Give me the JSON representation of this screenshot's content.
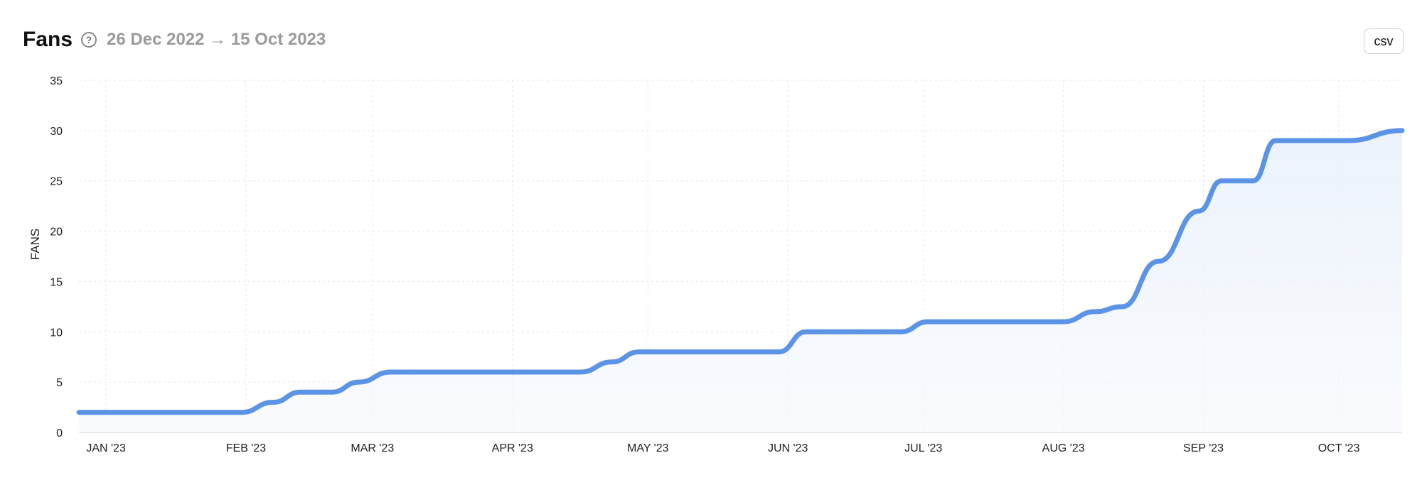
{
  "header": {
    "title": "Fans",
    "date_range": "26 Dec 2022 → 15 Oct 2023",
    "help_icon": "question-circle-icon"
  },
  "toolbar": {
    "csv_label": "csv"
  },
  "colors": {
    "line": "#5b93e6",
    "area_fill": "#eef4fc",
    "grid": "#e6e6e6",
    "axis": "#dddddd"
  },
  "chart_data": {
    "type": "line",
    "title": "Fans",
    "ylabel": "FANS",
    "xlabel": "",
    "ylim": [
      0,
      35
    ],
    "yticks": [
      0,
      5,
      10,
      15,
      20,
      25,
      30,
      35
    ],
    "xlim": [
      "2022-12-26",
      "2023-10-15"
    ],
    "xticks": [
      {
        "date": "2023-01-01",
        "label": "JAN '23"
      },
      {
        "date": "2023-02-01",
        "label": "FEB '23"
      },
      {
        "date": "2023-03-01",
        "label": "MAR '23"
      },
      {
        "date": "2023-04-01",
        "label": "APR '23"
      },
      {
        "date": "2023-05-01",
        "label": "MAY '23"
      },
      {
        "date": "2023-06-01",
        "label": "JUN '23"
      },
      {
        "date": "2023-07-01",
        "label": "JUL '23"
      },
      {
        "date": "2023-08-01",
        "label": "AUG '23"
      },
      {
        "date": "2023-09-01",
        "label": "SEP '23"
      },
      {
        "date": "2023-10-01",
        "label": "OCT '23"
      }
    ],
    "grid": true,
    "series": [
      {
        "points": [
          {
            "x": "2022-12-26",
            "y": 2
          },
          {
            "x": "2023-01-31",
            "y": 2
          },
          {
            "x": "2023-02-07",
            "y": 3
          },
          {
            "x": "2023-02-13",
            "y": 4
          },
          {
            "x": "2023-02-20",
            "y": 4
          },
          {
            "x": "2023-02-26",
            "y": 5
          },
          {
            "x": "2023-03-05",
            "y": 6
          },
          {
            "x": "2023-04-16",
            "y": 6
          },
          {
            "x": "2023-04-23",
            "y": 7
          },
          {
            "x": "2023-04-29",
            "y": 8
          },
          {
            "x": "2023-05-30",
            "y": 8
          },
          {
            "x": "2023-06-05",
            "y": 10
          },
          {
            "x": "2023-06-26",
            "y": 10
          },
          {
            "x": "2023-07-02",
            "y": 11
          },
          {
            "x": "2023-08-01",
            "y": 11
          },
          {
            "x": "2023-08-08",
            "y": 12
          },
          {
            "x": "2023-08-14",
            "y": 12.5
          },
          {
            "x": "2023-08-22",
            "y": 17
          },
          {
            "x": "2023-08-31",
            "y": 22
          },
          {
            "x": "2023-09-05",
            "y": 25
          },
          {
            "x": "2023-09-12",
            "y": 25
          },
          {
            "x": "2023-09-17",
            "y": 29
          },
          {
            "x": "2023-10-03",
            "y": 29
          },
          {
            "x": "2023-10-15",
            "y": 30
          }
        ]
      }
    ]
  }
}
